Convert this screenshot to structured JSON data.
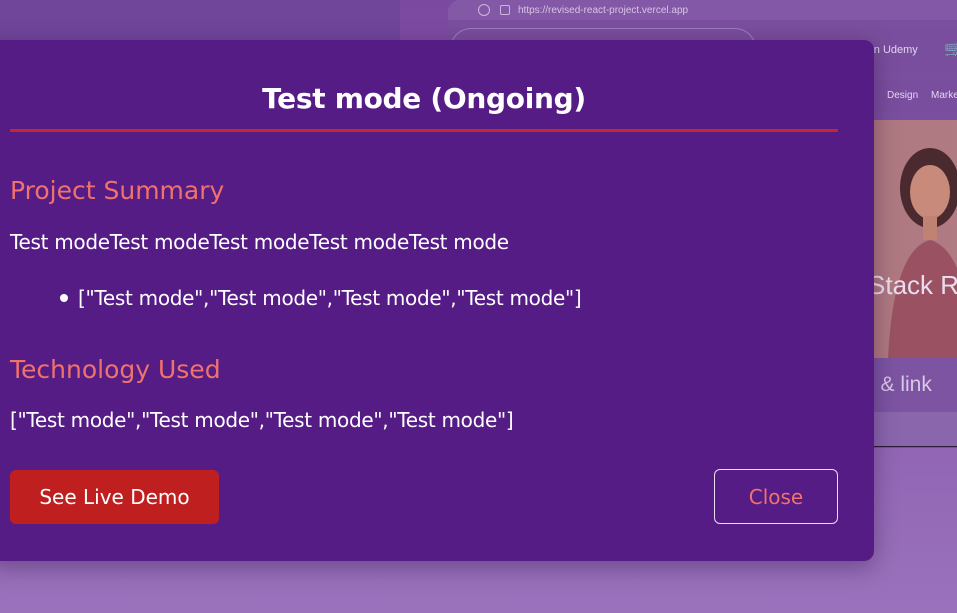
{
  "background": {
    "url": "https://revised-react-project.vercel.app",
    "nav_link": "ch on Udemy",
    "categories": [
      "Design",
      "Marke"
    ],
    "hero_text": "Stack R",
    "band_text": "o & link"
  },
  "modal": {
    "title": "Test mode (Ongoing)",
    "summary_heading": "Project Summary",
    "summary_text": "Test modeTest modeTest modeTest modeTest mode",
    "summary_bullets": [
      "[\"Test mode\",\"Test mode\",\"Test mode\",\"Test mode\"]"
    ],
    "tech_heading": "Technology Used",
    "tech_text": "[\"Test mode\",\"Test mode\",\"Test mode\",\"Test mode\"]",
    "demo_button": "See Live Demo",
    "close_button": "Close"
  },
  "colors": {
    "modal_bg": "#561c86",
    "accent_heading": "#f0726c",
    "divider": "#c2282d",
    "demo_button_bg": "#c01f20"
  }
}
